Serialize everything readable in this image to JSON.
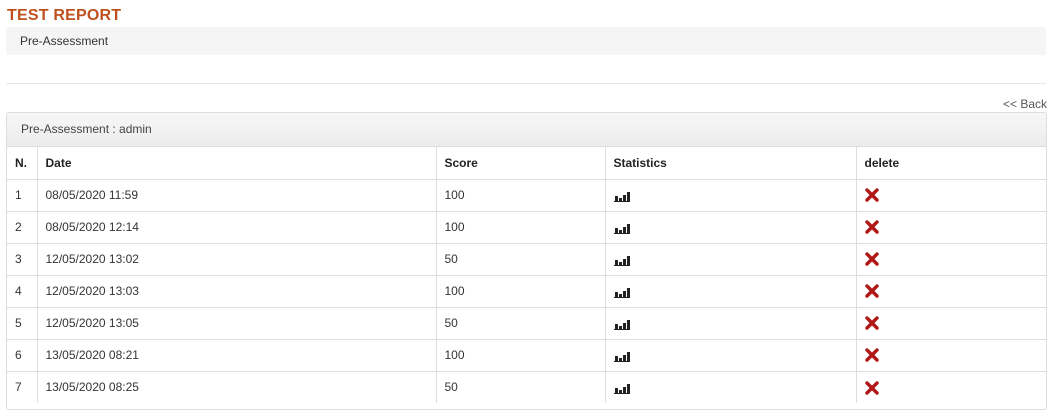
{
  "page": {
    "title": "TEST REPORT",
    "breadcrumb": "Pre-Assessment",
    "back_label": "<< Back"
  },
  "panel": {
    "heading": "Pre-Assessment : admin"
  },
  "table": {
    "headers": [
      "N.",
      "Date",
      "Score",
      "Statistics",
      "delete"
    ],
    "rows": [
      {
        "n": "1",
        "date": "08/05/2020 11:59",
        "score": "100"
      },
      {
        "n": "2",
        "date": "08/05/2020 12:14",
        "score": "100"
      },
      {
        "n": "3",
        "date": "12/05/2020 13:02",
        "score": "50"
      },
      {
        "n": "4",
        "date": "12/05/2020 13:03",
        "score": "100"
      },
      {
        "n": "5",
        "date": "12/05/2020 13:05",
        "score": "50"
      },
      {
        "n": "6",
        "date": "13/05/2020 08:21",
        "score": "100"
      },
      {
        "n": "7",
        "date": "13/05/2020 08:25",
        "score": "50"
      }
    ],
    "statistics_icon": "bar-chart-icon",
    "delete_icon": "delete-x-icon"
  },
  "colors": {
    "title": "#c0501e",
    "delete": "#b01818",
    "breadcrumb_bg": "#f5f5f5",
    "border": "#dddddd"
  }
}
